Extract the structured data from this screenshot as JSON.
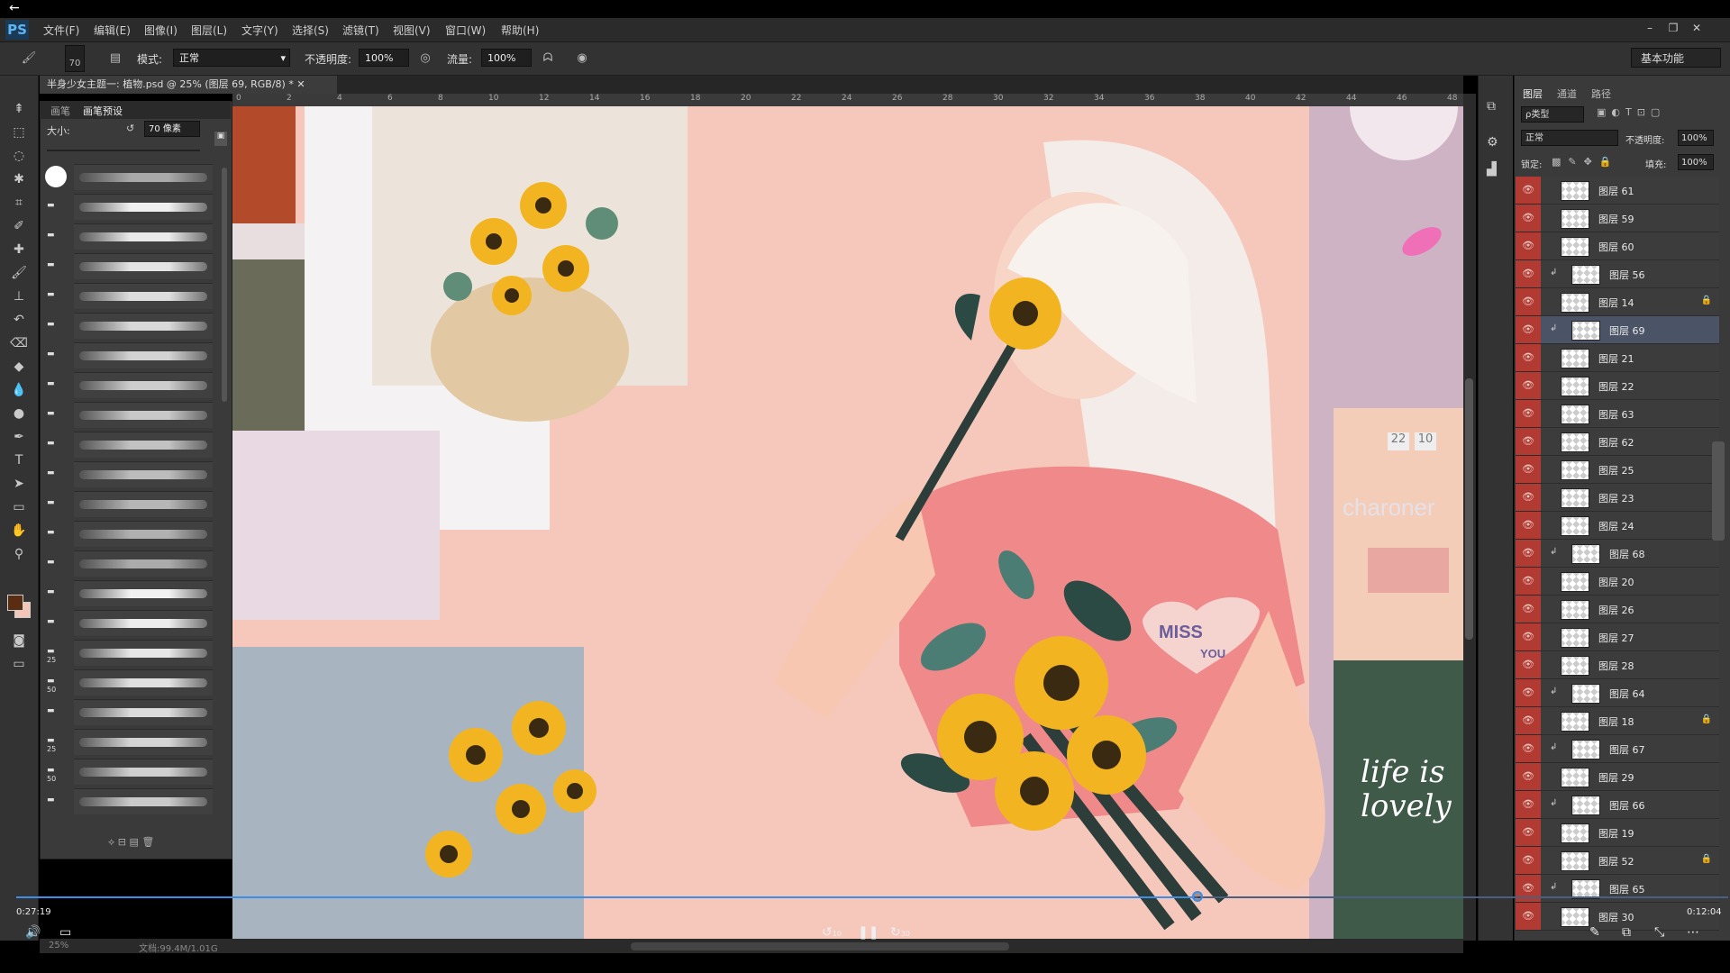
{
  "app": {
    "logo": "PS",
    "back_icon": "back-arrow-icon",
    "menu": [
      "文件(F)",
      "编辑(E)",
      "图像(I)",
      "图层(L)",
      "文字(Y)",
      "选择(S)",
      "滤镜(T)",
      "视图(V)",
      "窗口(W)",
      "帮助(H)"
    ],
    "window_controls": [
      "–",
      "❐",
      "✕"
    ]
  },
  "options": {
    "brush_size": "70",
    "mode_label": "模式:",
    "mode_value": "正常",
    "opacity_label": "不透明度:",
    "opacity_value": "100%",
    "flow_label": "流量:",
    "flow_value": "100%",
    "workspace": "基本功能"
  },
  "document": {
    "tab_title": "半身少女主题一: 植物.psd @ 25% (图层 69, RGB/8) *",
    "status": "文档:99.4M/1.01G",
    "zoom": "25%"
  },
  "brush_panel": {
    "tabs": [
      "画笔",
      "画笔预设"
    ],
    "size_label": "大小:",
    "size_value": "70 像素",
    "brush_numbers": [
      "",
      "",
      "",
      "",
      "",
      "",
      "",
      "",
      "",
      "",
      "",
      "",
      "",
      "",
      "",
      "",
      "25",
      "50",
      "",
      "25",
      "50",
      "",
      ""
    ]
  },
  "ruler": [
    "0",
    "2",
    "4",
    "6",
    "8",
    "10",
    "12",
    "14",
    "16",
    "18",
    "20",
    "22",
    "24",
    "26",
    "28",
    "30",
    "32",
    "34",
    "36",
    "38",
    "40",
    "42",
    "44",
    "46",
    "48"
  ],
  "artwork": {
    "shirt_text_1": "MISS",
    "shirt_text_2": "YOU",
    "ref_watermark": "charoner",
    "ref_clock_1": "22",
    "ref_clock_2": "10",
    "ref_lettering": "life is lovely"
  },
  "layers_panel": {
    "tabs": [
      "图层",
      "通道",
      "路径"
    ],
    "filter_label": "ρ类型",
    "blend_mode": "正常",
    "opacity_label": "不透明度:",
    "opacity_value": "100%",
    "lock_label": "锁定:",
    "fill_label": "填充:",
    "fill_value": "100%",
    "layers": [
      {
        "name": "图层 61",
        "clip": false,
        "locked": false,
        "selected": false
      },
      {
        "name": "图层 59",
        "clip": false,
        "locked": false,
        "selected": false
      },
      {
        "name": "图层 60",
        "clip": false,
        "locked": false,
        "selected": false
      },
      {
        "name": "图层 56",
        "clip": true,
        "locked": false,
        "selected": false
      },
      {
        "name": "图层 14",
        "clip": false,
        "locked": true,
        "selected": false
      },
      {
        "name": "图层 69",
        "clip": true,
        "locked": false,
        "selected": true
      },
      {
        "name": "图层 21",
        "clip": false,
        "locked": false,
        "selected": false
      },
      {
        "name": "图层 22",
        "clip": false,
        "locked": false,
        "selected": false
      },
      {
        "name": "图层 63",
        "clip": false,
        "locked": false,
        "selected": false
      },
      {
        "name": "图层 62",
        "clip": false,
        "locked": false,
        "selected": false
      },
      {
        "name": "图层 25",
        "clip": false,
        "locked": false,
        "selected": false
      },
      {
        "name": "图层 23",
        "clip": false,
        "locked": false,
        "selected": false
      },
      {
        "name": "图层 24",
        "clip": false,
        "locked": false,
        "selected": false
      },
      {
        "name": "图层 68",
        "clip": true,
        "locked": false,
        "selected": false
      },
      {
        "name": "图层 20",
        "clip": false,
        "locked": false,
        "selected": false
      },
      {
        "name": "图层 26",
        "clip": false,
        "locked": false,
        "selected": false
      },
      {
        "name": "图层 27",
        "clip": false,
        "locked": false,
        "selected": false
      },
      {
        "name": "图层 28",
        "clip": false,
        "locked": false,
        "selected": false
      },
      {
        "name": "图层 64",
        "clip": true,
        "locked": false,
        "selected": false
      },
      {
        "name": "图层 18",
        "clip": false,
        "locked": true,
        "selected": false
      },
      {
        "name": "图层 67",
        "clip": true,
        "locked": false,
        "selected": false
      },
      {
        "name": "图层 29",
        "clip": false,
        "locked": false,
        "selected": false
      },
      {
        "name": "图层 66",
        "clip": true,
        "locked": false,
        "selected": false
      },
      {
        "name": "图层 19",
        "clip": false,
        "locked": false,
        "selected": false
      },
      {
        "name": "图层 52",
        "clip": false,
        "locked": true,
        "selected": false
      },
      {
        "name": "图层 65",
        "clip": true,
        "locked": false,
        "selected": false
      },
      {
        "name": "图层 30",
        "clip": false,
        "locked": false,
        "selected": false
      }
    ]
  },
  "player": {
    "current_time": "0:27:19",
    "total_time": "0:12:04",
    "progress": 0.69,
    "rewind_label": "10",
    "forward_label": "30"
  },
  "colors": {
    "canvas_bg": "#f6c8bc",
    "eye_red": "#b13b32",
    "progress_blue": "#3c8ee8",
    "shirt": "#f08a8a"
  }
}
